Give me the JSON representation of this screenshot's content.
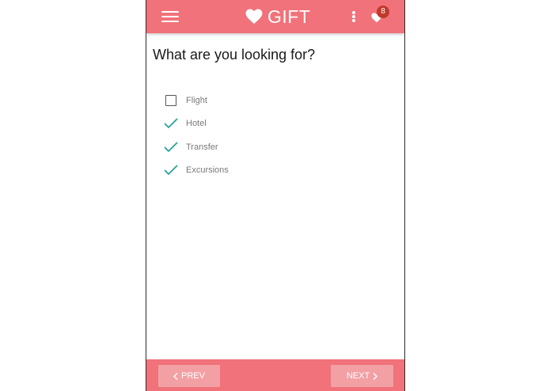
{
  "header": {
    "brand": "GIFT",
    "favorites_count": "8",
    "icons": {
      "menu": "hamburger-menu-icon",
      "logo": "heart-icon",
      "more": "vertical-dots-icon",
      "favorites": "heart-icon"
    }
  },
  "question": {
    "title": "What are you looking for?"
  },
  "options": [
    {
      "label": "Flight",
      "checked": false
    },
    {
      "label": "Hotel",
      "checked": true
    },
    {
      "label": "Transfer",
      "checked": true
    },
    {
      "label": "Excursions",
      "checked": true
    }
  ],
  "footer": {
    "prev_label": "PREV",
    "next_label": "NEXT"
  },
  "colors": {
    "primary": "#f1727a",
    "button": "#f3a0a5",
    "check": "#1a9e96",
    "badge": "#c0392b"
  }
}
